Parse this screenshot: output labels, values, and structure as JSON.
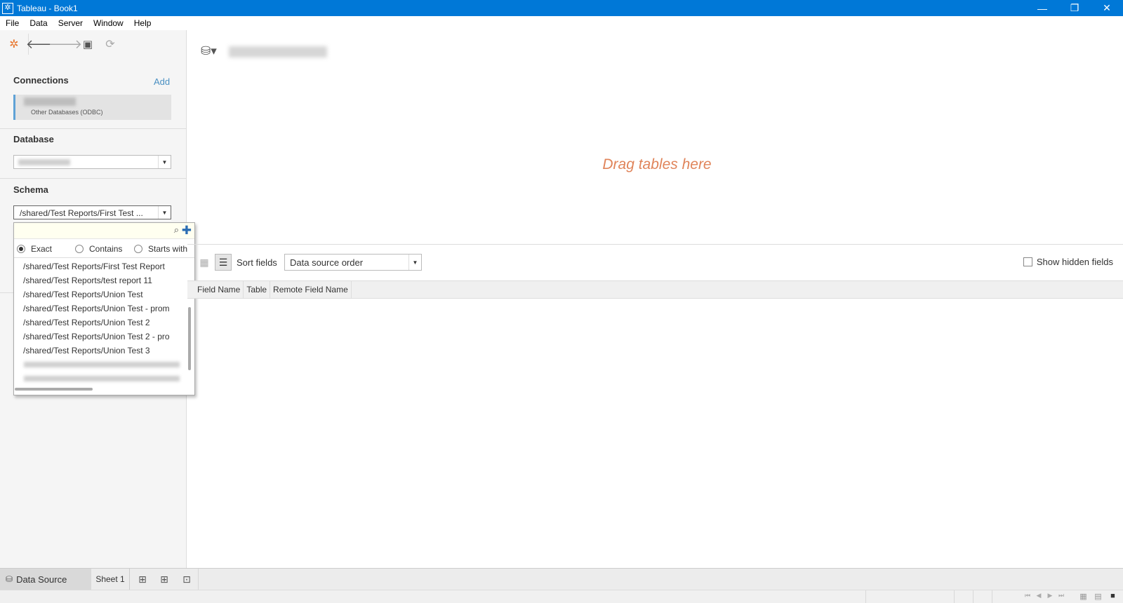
{
  "window": {
    "title": "Tableau - Book1",
    "controls": {
      "minimize": "—",
      "restore": "❐",
      "close": "✕"
    }
  },
  "menu": [
    "File",
    "Data",
    "Server",
    "Window",
    "Help"
  ],
  "toolbar": {
    "icons": [
      "tableau-logo-icon",
      "back-arrow-icon",
      "forward-arrow-icon",
      "save-icon",
      "refresh-icon"
    ]
  },
  "connections": {
    "title": "Connections",
    "add_label": "Add",
    "item": {
      "type": "Other Databases (ODBC)"
    }
  },
  "database": {
    "title": "Database"
  },
  "schema": {
    "title": "Schema",
    "selected": "/shared/Test Reports/First Test ..."
  },
  "schema_popup": {
    "search_value": "",
    "match_modes": {
      "exact": "Exact",
      "contains": "Contains",
      "starts_with": "Starts with",
      "selected": "Exact"
    },
    "items": [
      "/shared/Test Reports/First Test Report",
      "/shared/Test Reports/test report 11",
      "/shared/Test Reports/Union Test",
      "/shared/Test Reports/Union Test - prom",
      "/shared/Test Reports/Union Test 2",
      "/shared/Test Reports/Union Test 2 - pro",
      "/shared/Test Reports/Union Test 3"
    ]
  },
  "canvas": {
    "drag_hint": "Drag tables here"
  },
  "fields": {
    "sort_label": "Sort fields",
    "sort_value": "Data source order",
    "show_hidden_label": "Show hidden fields",
    "columns": [
      "Field Name",
      "Table",
      "Remote Field Name"
    ]
  },
  "tabs": {
    "datasource": "Data Source",
    "sheet1": "Sheet 1",
    "new_tab_icons": [
      "new-worksheet-icon",
      "new-dashboard-icon",
      "new-story-icon"
    ]
  },
  "colors": {
    "titlebar": "#0078d7",
    "drag_hint": "#e0845a",
    "accent_link": "#4a90c2"
  }
}
